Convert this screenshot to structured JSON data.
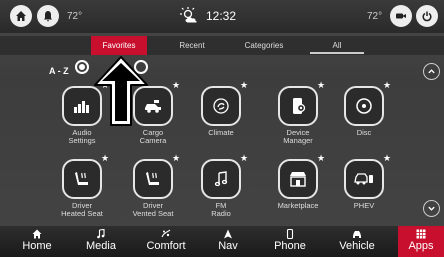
{
  "status": {
    "temp_left": "72°",
    "time": "12:32",
    "temp_right": "72°"
  },
  "tabs": [
    {
      "label": "Favorites"
    },
    {
      "label": "Recent"
    },
    {
      "label": "Categories"
    },
    {
      "label": "All"
    }
  ],
  "sort": {
    "label": "A - Z"
  },
  "apps": [
    {
      "label": "Audio\nSettings"
    },
    {
      "label": "Cargo\nCamera"
    },
    {
      "label": "Climate"
    },
    {
      "label": "Device\nManager"
    },
    {
      "label": "Disc"
    },
    {
      "label": "Driver\nHeated Seat"
    },
    {
      "label": "Driver\nVented Seat"
    },
    {
      "label": "FM\nRadio"
    },
    {
      "label": "Marketplace"
    },
    {
      "label": "PHEV"
    }
  ],
  "nav": [
    {
      "label": "Home"
    },
    {
      "label": "Media"
    },
    {
      "label": "Comfort"
    },
    {
      "label": "Nav"
    },
    {
      "label": "Phone"
    },
    {
      "label": "Vehicle"
    },
    {
      "label": "Apps"
    }
  ],
  "colors": {
    "accent": "#c8102e"
  }
}
